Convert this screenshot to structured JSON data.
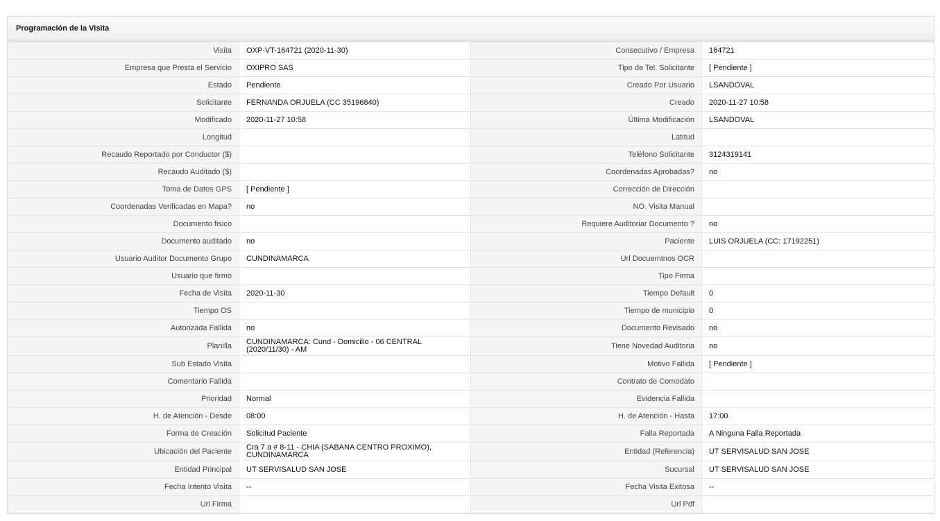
{
  "panel": {
    "title": "Programación de la Visita"
  },
  "rows": [
    {
      "l1": "Visita",
      "v1": "OXP-VT-164721 (2020-11-30)",
      "l2": "Consecutivo / Empresa",
      "v2": "164721"
    },
    {
      "l1": "Empresa que Presta el Servicio",
      "v1": "OXIPRO SAS",
      "l2": "Tipo de Tel. Solicitante",
      "v2": "[ Pendiente ]"
    },
    {
      "l1": "Estado",
      "v1": "Pendiente",
      "l2": "Creado Por Usuario",
      "v2": "LSANDOVAL"
    },
    {
      "l1": "Solicitante",
      "v1": "FERNANDA ORJUELA (CC 35196840)",
      "l2": "Creado",
      "v2": "2020-11-27 10:58"
    },
    {
      "l1": "Modificado",
      "v1": "2020-11-27 10:58",
      "l2": "Última Modificación",
      "v2": " LSANDOVAL"
    },
    {
      "l1": "Longitud",
      "v1": "",
      "l2": "Latitud",
      "v2": ""
    },
    {
      "l1": "Recaudo Reportado por Conductor ($)",
      "v1": "",
      "l2": "Teléfono Solicitante",
      "v2": "3124319141"
    },
    {
      "l1": "Recaudo Auditado ($)",
      "v1": "",
      "l2": "Coordenadas Aprobadas?",
      "v2": " no"
    },
    {
      "l1": "Toma de Datos GPS",
      "v1": "[ Pendiente ]",
      "l2": "Corrección de Dirección",
      "v2": ""
    },
    {
      "l1": "Coordenadas Verificadas en Mapa?",
      "v1": " no",
      "l2": "NO. Visita Manual",
      "v2": ""
    },
    {
      "l1": "Documento fisico",
      "v1": "",
      "l2": "Requiere Auditoriar Documento ?",
      "v2": " no"
    },
    {
      "l1": "Documento auditado",
      "v1": " no",
      "l2": "Paciente",
      "v2": "LUIS ORJUELA (CC: 17192251)"
    },
    {
      "l1": "Usuario Auditor Documento Grupo",
      "v1": "CUNDINAMARCA",
      "l2": "Url Docuemtnos OCR",
      "v2": ""
    },
    {
      "l1": "Usuario que firmo",
      "v1": "",
      "l2": "Tipo Firma",
      "v2": ""
    },
    {
      "l1": "Fecha de Visita",
      "v1": " 2020-11-30",
      "l2": "Tiempo Default",
      "v2": "0"
    },
    {
      "l1": "Tiempo OS",
      "v1": "",
      "l2": "Tiempo de municipio",
      "v2": "0"
    },
    {
      "l1": "Autorizada Fallida",
      "v1": " no",
      "l2": "Documento Revisado",
      "v2": " no"
    },
    {
      "l1": "Planilla",
      "v1": "CUNDINAMARCA: Cund - Domicilio - 06 CENTRAL (2020/11/30) - AM",
      "l2": "Tiene Novedad Auditoria",
      "v2": " no"
    },
    {
      "l1": "Sub Estado Visita",
      "v1": "",
      "l2": "Motivo Fallida",
      "v2": "[ Pendiente ]"
    },
    {
      "l1": "Comentario Fallida",
      "v1": "",
      "l2": "Contrato de Comodato",
      "v2": ""
    },
    {
      "l1": "Prioridad",
      "v1": "Normal",
      "l2": "Evidencia Fallida",
      "v2": ""
    },
    {
      "l1": "H. de Atención - Desde",
      "v1": "08:00",
      "l2": "H. de Atención - Hasta",
      "v2": "17:00"
    },
    {
      "l1": "Forma de Creación",
      "v1": "Solicitud Paciente",
      "l2": "Falla Reportada",
      "v2": "A Ninguna Falla Reportada"
    },
    {
      "l1": "Ubicación del Paciente",
      "v1": "Cra 7 a # 8-11 - CHIA (SABANA CENTRO PROXIMO), CUNDINAMARCA",
      "l2": "Entidad (Referencia)",
      "v2": "UT SERVISALUD SAN JOSE"
    },
    {
      "l1": "Entidad Principal",
      "v1": "UT SERVISALUD SAN JOSE",
      "l2": "Sucursal",
      "v2": "UT SERVISALUD SAN JOSE"
    },
    {
      "l1": "Fecha Intento Visita",
      "v1": " --",
      "l2": "Fecha Visita Exitosa",
      "v2": " --"
    },
    {
      "l1": "Url Firma",
      "v1": "",
      "l2": "Url Pdf",
      "v2": ""
    }
  ]
}
